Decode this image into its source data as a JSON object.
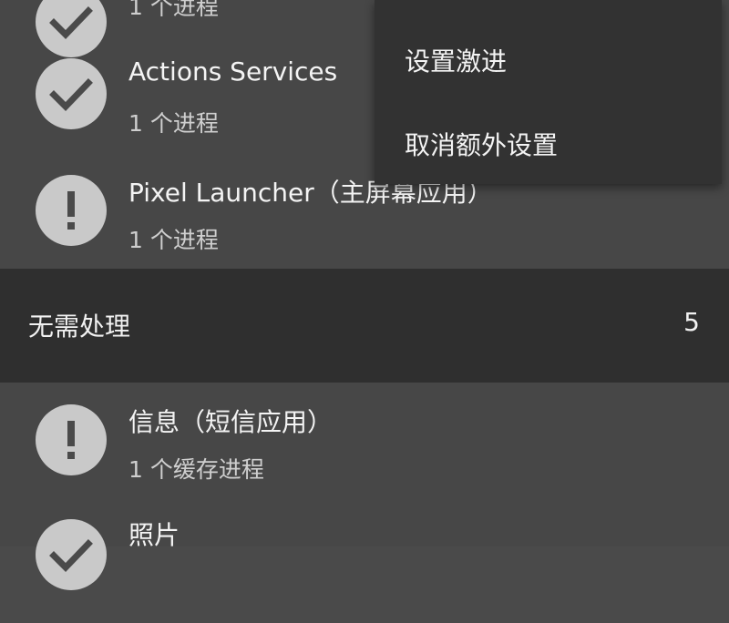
{
  "menu": {
    "items": [
      {
        "label": "设置激进"
      },
      {
        "label": "取消额外设置"
      }
    ]
  },
  "list": {
    "partial_top_subtitle": "1 个进程",
    "items": [
      {
        "title": "Actions Services",
        "subtitle": "1 个进程",
        "icon": "check-icon"
      },
      {
        "title": "Pixel Launcher（主屏幕应用）",
        "subtitle": "1 个进程",
        "icon": "exclamation-icon"
      }
    ]
  },
  "section": {
    "title": "无需处理",
    "count": "5",
    "items": [
      {
        "title": "信息（短信应用）",
        "subtitle": "1 个缓存进程",
        "icon": "exclamation-icon"
      },
      {
        "title": "照片",
        "subtitle": "",
        "icon": "check-icon"
      }
    ]
  },
  "colors": {
    "background": "#4a4a4a",
    "section_header": "#2f2f2f",
    "menu_background": "#323232",
    "icon_circle": "#c9c9c9",
    "icon_glyph": "#4a4a4a"
  }
}
